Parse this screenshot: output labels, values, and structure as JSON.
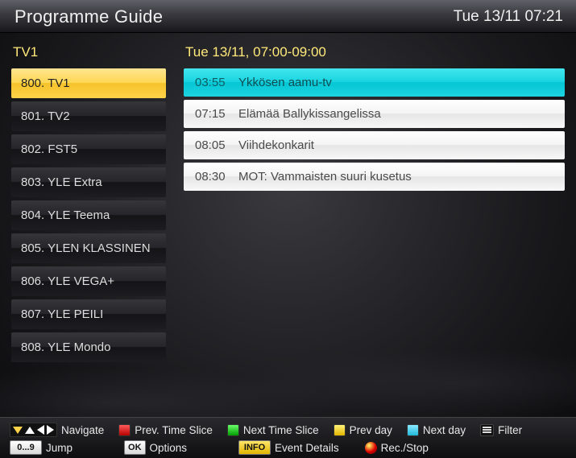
{
  "header": {
    "title": "Programme Guide",
    "clock": "Tue 13/11 07:21"
  },
  "left": {
    "heading": "TV1",
    "channels": [
      {
        "label": "800. TV1",
        "selected": true
      },
      {
        "label": "801. TV2"
      },
      {
        "label": "802. FST5"
      },
      {
        "label": "803. YLE Extra"
      },
      {
        "label": "804. YLE Teema"
      },
      {
        "label": "805. YLEN KLASSINEN"
      },
      {
        "label": "806. YLE VEGA+"
      },
      {
        "label": "807. YLE PEILI"
      },
      {
        "label": "808. YLE Mondo"
      }
    ]
  },
  "right": {
    "heading": "Tue 13/11, 07:00-09:00",
    "programmes": [
      {
        "time": "03:55",
        "title": "Ykkösen aamu-tv",
        "selected": true
      },
      {
        "time": "07:15",
        "title": "Elämää Ballykissangelissa"
      },
      {
        "time": "08:05",
        "title": "Viihdekonkarit"
      },
      {
        "time": "08:30",
        "title": "MOT: Vammaisten suuri kusetus"
      }
    ]
  },
  "help": {
    "navigate": "Navigate",
    "prev_slice": "Prev. Time Slice",
    "next_slice": "Next Time Slice",
    "prev_day": "Prev day",
    "next_day": "Next day",
    "filter": "Filter",
    "jump_key": "0...9",
    "jump": "Jump",
    "ok_key": "OK",
    "options": "Options",
    "info_key": "INFO",
    "event_details": "Event Details",
    "rec_stop": "Rec./Stop"
  }
}
